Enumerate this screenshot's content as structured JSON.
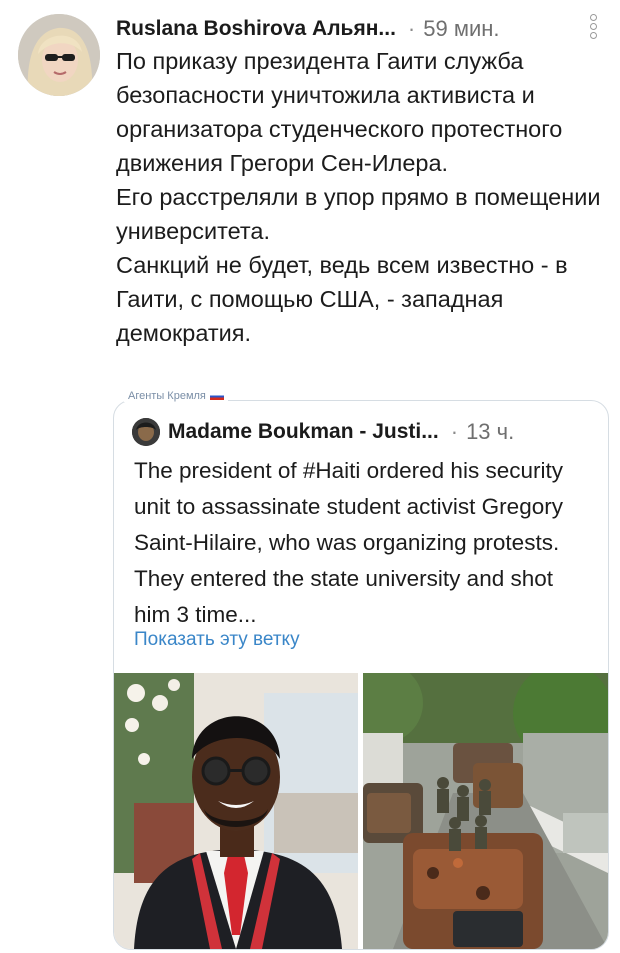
{
  "tweet": {
    "author": "Ruslana Boshirova Альян...",
    "separator": "·",
    "time": "59 мин.",
    "body_lines": [
      "По приказу президента Гаити служба безопасности уничтожила активиста и организатора студенческого протестного движения Грегори Сен-Илера.",
      "Его расстреляли в упор прямо в помещении университета.",
      "Санкций не будет, ведь всем известно - в Гаити, с помощью США, - западная демократия."
    ]
  },
  "watermark": {
    "label": "Агенты Кремля"
  },
  "quoted_tweet": {
    "author": "Madame Boukman - Justi...",
    "separator": "·",
    "time": "13 ч.",
    "text": "The president of #Haiti ordered his security unit to assassinate student activist Gregory Saint-Hilaire, who was organizing protests. They entered the state university and  shot him 3 time...",
    "show_thread": "Показать эту ветку"
  },
  "colors": {
    "link": "#3a86c8",
    "border": "#d6dde3",
    "muted": "#6f6f6f"
  },
  "icons": [
    "more-vertical-icon",
    "avatar",
    "russian-flag-icon"
  ]
}
